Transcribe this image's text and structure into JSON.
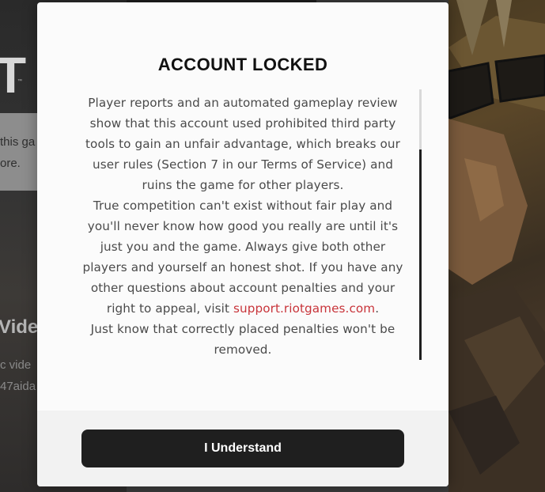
{
  "background": {
    "logo_text": "T",
    "logo_mark": "™",
    "card_line_1": "this ga",
    "card_line_2": "ore.",
    "video_title": "Vide",
    "video_line_1": "c vide",
    "video_line_2": "47aida"
  },
  "modal": {
    "title": "ACCOUNT LOCKED",
    "paragraph_1": "Player reports and an automated gameplay review show that this account used prohibited third party tools to gain an unfair advantage, which breaks our user rules (Section 7 in our Terms of Service) and ruins the game for other players.",
    "paragraph_2_before_link": "True competition can't exist without fair play and you'll never know how good you really are until it's just you and the game. Always give both other players and yourself an honest shot. If you have any other questions about account penalties and your right to appeal, visit ",
    "support_link": "support.riotgames.com",
    "paragraph_2_after_link": ".",
    "paragraph_3": "Just know that correctly placed penalties won't be removed.",
    "confirm_label": "I Understand"
  },
  "colors": {
    "link": "#c8343a",
    "button": "#1f1f1f",
    "modal_bg": "#fbfbfb",
    "footer_bg": "#f2f2f2"
  }
}
